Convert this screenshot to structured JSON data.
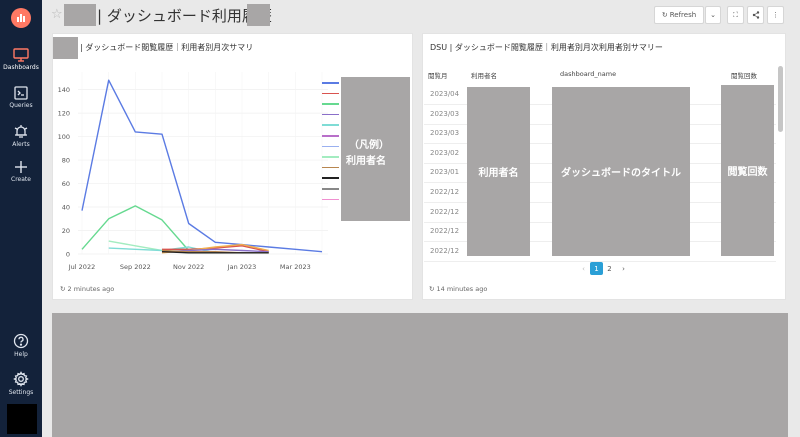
{
  "sidebar": {
    "items": [
      {
        "label": "Dashboards",
        "icon": "desktop-icon"
      },
      {
        "label": "Queries",
        "icon": "terminal-icon"
      },
      {
        "label": "Alerts",
        "icon": "bell-icon"
      },
      {
        "label": "Create",
        "icon": "plus-icon"
      }
    ],
    "bottom_items": [
      {
        "label": "Help",
        "icon": "help-icon"
      },
      {
        "label": "Settings",
        "icon": "gear-icon"
      }
    ]
  },
  "header": {
    "title": "| ダッシュボード利用履歴",
    "refresh_label": "Refresh"
  },
  "left_widget": {
    "title": "| ダッシュボード閲覧履歴｜利用者別月次サマリ",
    "legend_redacted_label_1": "（凡例）",
    "legend_redacted_label_2": "利用者名",
    "footer": "2 minutes ago"
  },
  "right_widget": {
    "title": "DSU | ダッシュボード閲覧履歴｜利用者別月次利用者別サマリー",
    "columns": [
      "閲覧月",
      "利用者名",
      "dashboard_name",
      "閲覧回数"
    ],
    "dates": [
      "2023/04",
      "2023/03",
      "2023/03",
      "2023/02",
      "2023/01",
      "2022/12",
      "2022/12",
      "2022/12",
      "2022/12"
    ],
    "redacted_user": "利用者名",
    "redacted_dashboard": "ダッシュボードのタイトル",
    "redacted_count": "閲覧回数",
    "pages": [
      "1",
      "2"
    ],
    "prev": "‹",
    "next": "›",
    "footer": "14 minutes ago"
  },
  "colors": {
    "sidebar_bg": "#13223a",
    "accent": "#ff7964",
    "redaction": "#a8a6a6",
    "pagination_active": "#2a9fd6"
  },
  "chart_data": {
    "type": "line",
    "x": [
      "2022-07",
      "2022-08",
      "2022-09",
      "2022-10",
      "2022-11",
      "2022-12",
      "2023-01",
      "2023-02",
      "2023-03",
      "2023-04"
    ],
    "x_tick_labels": [
      "Jul 2022",
      "Sep 2022",
      "Nov 2022",
      "Jan 2023",
      "Mar 2023"
    ],
    "y_ticks": [
      0,
      20,
      40,
      60,
      80,
      100,
      120,
      140
    ],
    "ylim": [
      0,
      155
    ],
    "grid": true,
    "legend_position": "right",
    "series": [
      {
        "color": "#5b7be3",
        "values": [
          37,
          148,
          104,
          102,
          26,
          10,
          8,
          6,
          4,
          2
        ]
      },
      {
        "color": "#66d990",
        "values": [
          4,
          30,
          41,
          29,
          3,
          null,
          null,
          null,
          null,
          null
        ]
      },
      {
        "color": "#a3ecc0",
        "values": [
          null,
          11,
          7,
          3,
          1,
          null,
          null,
          null,
          null,
          null
        ]
      },
      {
        "color": "#7fdcd5",
        "values": [
          null,
          5,
          4,
          3,
          6,
          1,
          1,
          1,
          null,
          null
        ]
      },
      {
        "color": "#d9534f",
        "values": [
          null,
          null,
          null,
          4,
          4,
          5,
          7,
          2,
          null,
          null
        ]
      },
      {
        "color": "#f0ad4e",
        "values": [
          null,
          null,
          null,
          1,
          3,
          6,
          8,
          3,
          null,
          null
        ]
      },
      {
        "color": "#8a6fc9",
        "values": [
          null,
          null,
          null,
          2,
          3,
          4,
          3,
          2,
          null,
          null
        ]
      },
      {
        "color": "#b8864f",
        "values": [
          null,
          null,
          null,
          3,
          2,
          2,
          1,
          1,
          null,
          null
        ]
      },
      {
        "color": "#222222",
        "values": [
          null,
          null,
          null,
          2,
          1,
          1,
          1,
          1,
          null,
          null
        ]
      }
    ],
    "legend_colors": [
      "#5b7be3",
      "#d9534f",
      "#66d990",
      "#8a6fc9",
      "#7fdcd5",
      "#b86fc9",
      "#9ab0f0",
      "#a3ecc0",
      "#b8864f",
      "#222222",
      "#888888",
      "#f08fd0"
    ]
  }
}
